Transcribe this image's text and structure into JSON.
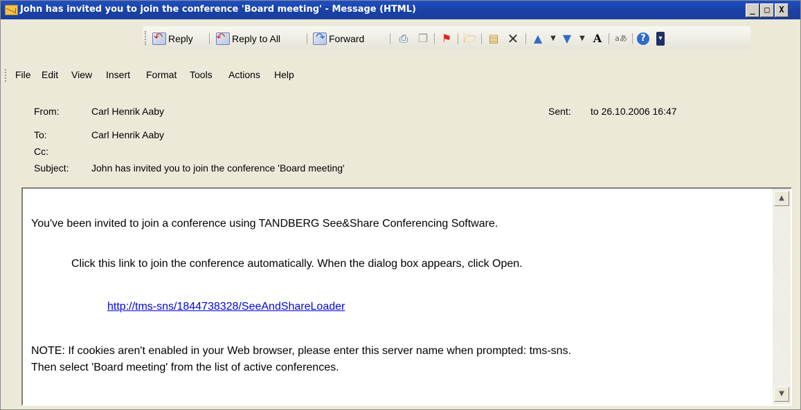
{
  "window": {
    "title": "John has invited you to join the conference 'Board meeting' - Message (HTML)",
    "controls": {
      "minimize": "_",
      "maximize": "□",
      "close": "X"
    }
  },
  "toolbar": {
    "reply": "Reply",
    "reply_all": "Reply to All",
    "forward": "Forward",
    "icons": [
      "print-icon",
      "copy-icon",
      "flag-icon",
      "folder-icon",
      "address-book-icon",
      "delete-icon",
      "previous-icon",
      "next-icon",
      "font-size-icon",
      "encoding-icon",
      "help-icon"
    ]
  },
  "menu": {
    "items": [
      "File",
      "Edit",
      "View",
      "Insert",
      "Format",
      "Tools",
      "Actions",
      "Help"
    ]
  },
  "header": {
    "from_label": "From:",
    "from_value": "Carl Henrik Aaby",
    "sent_label": "Sent:",
    "sent_value": "to 26.10.2006 16:47",
    "to_label": "To:",
    "to_value": "Carl Henrik Aaby",
    "cc_label": "Cc:",
    "cc_value": "",
    "subject_label": "Subject:",
    "subject_value": "John has invited you to join the conference 'Board meeting'"
  },
  "message": {
    "line1": "You've been invited to join a conference using TANDBERG See&Share Conferencing Software.",
    "line2": "Click this link to join the conference automatically. When the dialog box appears, click Open.",
    "link": "http://tms-sns/1844738328/SeeAndShareLoader",
    "note1": "NOTE: If cookies aren't enabled in your Web browser, please enter this server name when prompted: tms-sns.",
    "note2": "Then select 'Board meeting' from the list of active conferences."
  },
  "colors": {
    "titlebar": "#1941a5",
    "window_bg": "#ece9d8",
    "link": "#0000ee"
  }
}
